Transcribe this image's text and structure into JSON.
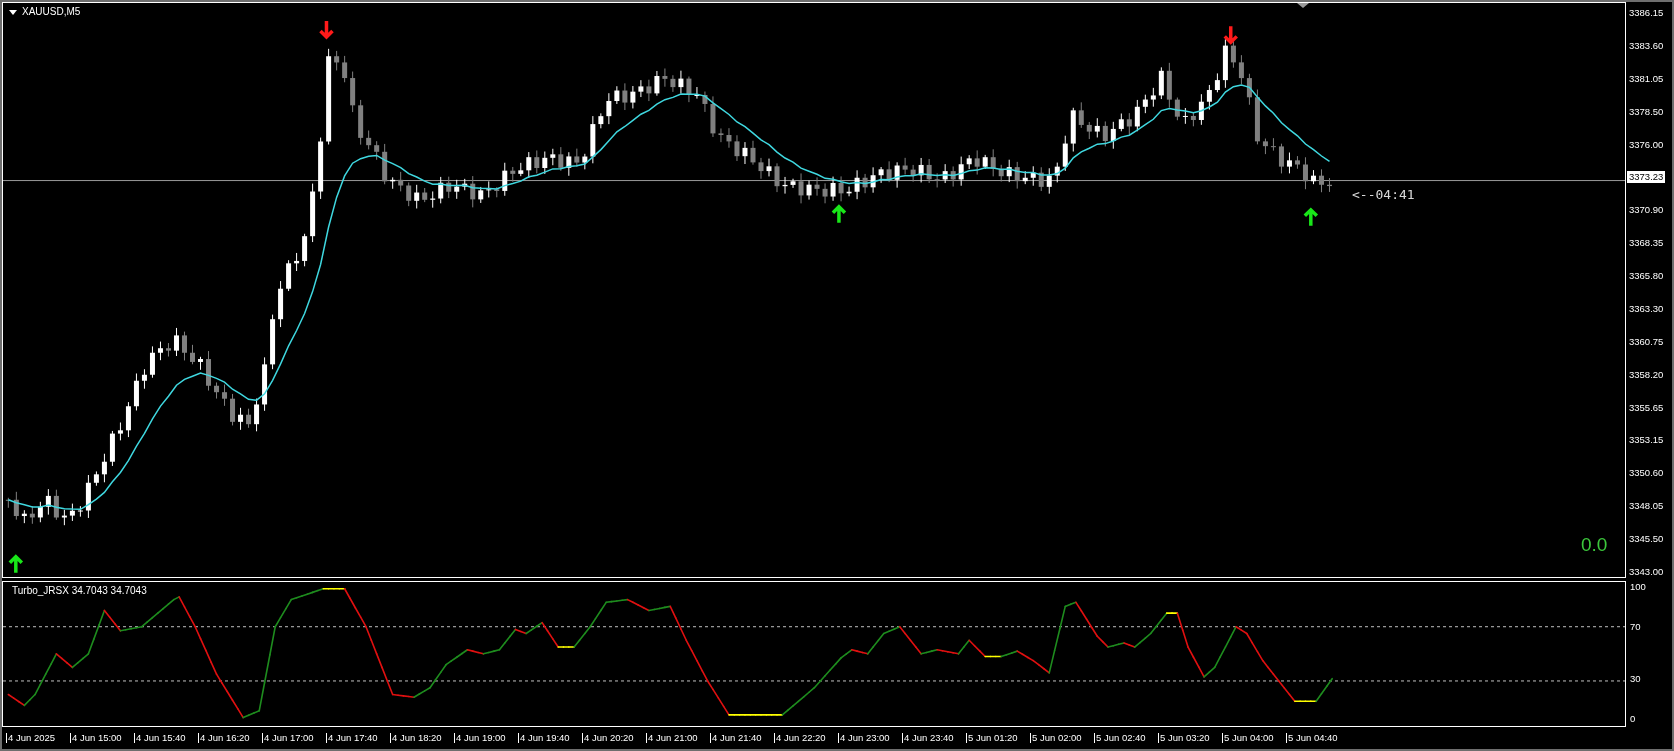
{
  "chart": {
    "symbol_label": "XAUUSD,M5",
    "price_axis": [
      {
        "kind": "tick",
        "label": "3386.15"
      },
      {
        "kind": "tick",
        "label": "3383.60"
      },
      {
        "kind": "tick",
        "label": "3381.05"
      },
      {
        "kind": "tick",
        "label": "3378.50"
      },
      {
        "kind": "tick",
        "label": "3376.00"
      },
      {
        "kind": "current",
        "label": "3373.23"
      },
      {
        "kind": "tick",
        "label": "3370.90"
      },
      {
        "kind": "tick",
        "label": "3368.35"
      },
      {
        "kind": "tick",
        "label": "3365.80"
      },
      {
        "kind": "tick",
        "label": "3363.30"
      },
      {
        "kind": "tick",
        "label": "3360.75"
      },
      {
        "kind": "tick",
        "label": "3358.20"
      },
      {
        "kind": "tick",
        "label": "3355.65"
      },
      {
        "kind": "tick",
        "label": "3353.15"
      },
      {
        "kind": "tick",
        "label": "3350.60"
      },
      {
        "kind": "tick",
        "label": "3348.05"
      },
      {
        "kind": "tick",
        "label": "3345.50"
      },
      {
        "kind": "tick",
        "label": "3343.00"
      }
    ],
    "countdown": "<--04:41",
    "signal_value": "0.0"
  },
  "indicator": {
    "label": "Turbo_JRSX 34.7043 34.7043",
    "levels": [
      "100",
      "70",
      "30",
      "0"
    ]
  },
  "time_axis": [
    "4 Jun 2025",
    "4 Jun 15:00",
    "4 Jun 15:40",
    "4 Jun 16:20",
    "4 Jun 17:00",
    "4 Jun 17:40",
    "4 Jun 18:20",
    "4 Jun 19:00",
    "4 Jun 19:40",
    "4 Jun 20:20",
    "4 Jun 21:00",
    "4 Jun 21:40",
    "4 Jun 22:20",
    "4 Jun 23:00",
    "4 Jun 23:40",
    "5 Jun 01:20",
    "5 Jun 02:00",
    "5 Jun 02:40",
    "5 Jun 03:20",
    "5 Jun 04:00",
    "5 Jun 04:40"
  ]
}
